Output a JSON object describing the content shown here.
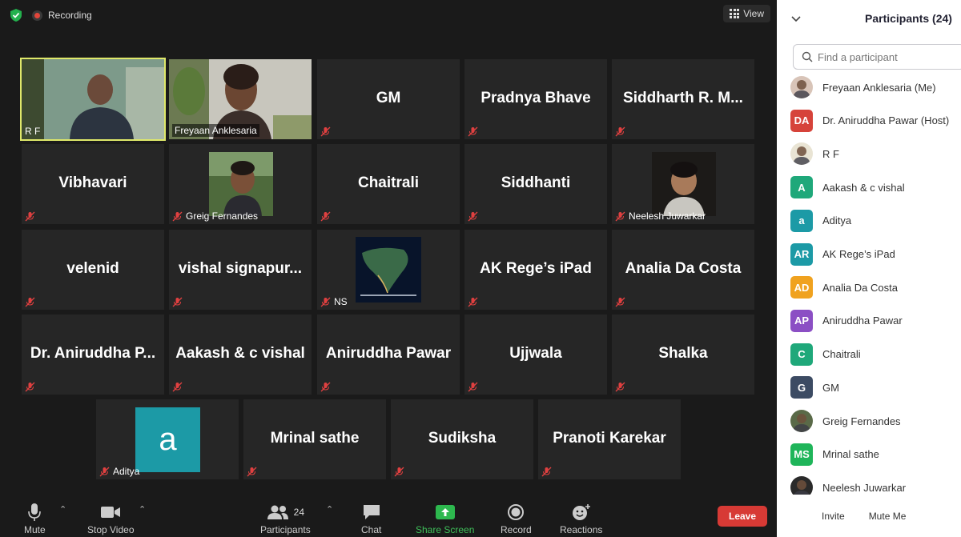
{
  "status": {
    "recording_label": "Recording"
  },
  "view": {
    "label": "View"
  },
  "tiles": [
    {
      "name": "R F",
      "type": "video-label"
    },
    {
      "name": "Freyaan Anklesaria",
      "type": "video-label"
    },
    {
      "name": "GM",
      "type": "name"
    },
    {
      "name": "Pradnya Bhave",
      "type": "name"
    },
    {
      "name": "Siddharth R. M...",
      "type": "name"
    },
    {
      "name": "Vibhavari",
      "type": "name"
    },
    {
      "name": "Greig Fernandes",
      "type": "video-label"
    },
    {
      "name": "Chaitrali",
      "type": "name"
    },
    {
      "name": "Siddhanti",
      "type": "name"
    },
    {
      "name": "Neelesh Juwarkar",
      "type": "video-label"
    },
    {
      "name": "velenid",
      "type": "name"
    },
    {
      "name": "vishal  signapur...",
      "type": "name"
    },
    {
      "name": "NS",
      "type": "video-label"
    },
    {
      "name": "AK Rege’s iPad",
      "type": "name"
    },
    {
      "name": "Analia Da Costa",
      "type": "name"
    },
    {
      "name": "Dr. Aniruddha P...",
      "type": "name"
    },
    {
      "name": "Aakash & c vishal",
      "type": "name"
    },
    {
      "name": "Aniruddha Pawar",
      "type": "name"
    },
    {
      "name": "Ujjwala",
      "type": "name"
    },
    {
      "name": "Shalka",
      "type": "name"
    },
    {
      "name": "Aditya",
      "type": "video-label"
    },
    {
      "name": "Mrinal sathe",
      "type": "name"
    },
    {
      "name": "Sudiksha",
      "type": "name"
    },
    {
      "name": "Pranoti Karekar",
      "type": "name"
    }
  ],
  "aditya_avatar_letter": "a",
  "toolbar": {
    "mute": "Mute",
    "stop_video": "Stop Video",
    "participants": "Participants",
    "participants_count": "24",
    "chat": "Chat",
    "share_screen": "Share Screen",
    "record": "Record",
    "reactions": "Reactions",
    "leave": "Leave"
  },
  "panel": {
    "title": "Participants (24)",
    "search_placeholder": "Find a participant",
    "participants": [
      {
        "name": "Freyaan Anklesaria (Me)",
        "initials": "",
        "color": "#d8c4b8"
      },
      {
        "name": "Dr. Aniruddha Pawar (Host)",
        "initials": "DA",
        "color": "#d6433a"
      },
      {
        "name": "R F",
        "initials": "",
        "color": "#e9e4d4"
      },
      {
        "name": "Aakash & c vishal",
        "initials": "A",
        "color": "#1fa87a"
      },
      {
        "name": "Aditya",
        "initials": "a",
        "color": "#1c9aa6"
      },
      {
        "name": "AK Rege’s iPad",
        "initials": "AR",
        "color": "#1c9aa6"
      },
      {
        "name": "Analia Da Costa",
        "initials": "AD",
        "color": "#f0a21f"
      },
      {
        "name": "Aniruddha Pawar",
        "initials": "AP",
        "color": "#8b4fc4"
      },
      {
        "name": "Chaitrali",
        "initials": "C",
        "color": "#1fa87a"
      },
      {
        "name": "GM",
        "initials": "G",
        "color": "#3c4b63"
      },
      {
        "name": "Greig Fernandes",
        "initials": "",
        "color": "#5a6a48"
      },
      {
        "name": "Mrinal sathe",
        "initials": "MS",
        "color": "#1fb55a"
      },
      {
        "name": "Neelesh Juwarkar",
        "initials": "",
        "color": "#2a2a2a"
      }
    ],
    "invite": "Invite",
    "mute_me": "Mute Me"
  }
}
